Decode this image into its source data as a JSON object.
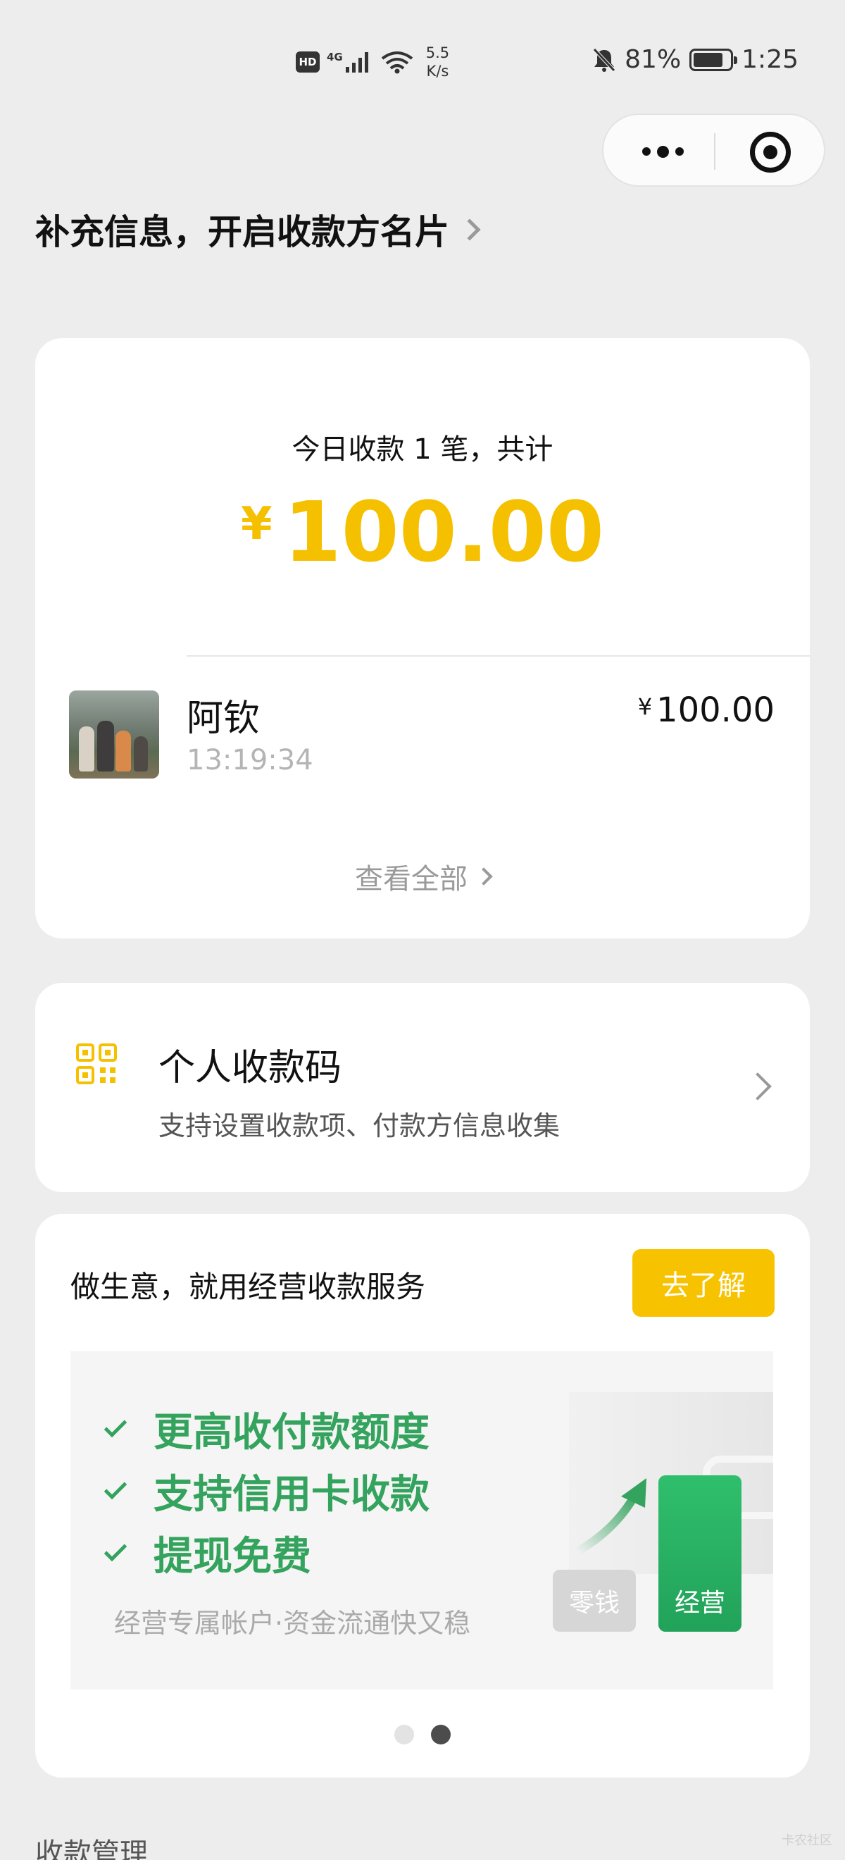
{
  "status_bar": {
    "hd": "HD",
    "network": "4G",
    "speed_value": "5.5",
    "speed_unit": "K/s",
    "battery_percent": "81%",
    "battery_level": 0.81,
    "time": "1:25",
    "icons": [
      "hd-icon",
      "signal-icon",
      "wifi-icon",
      "mute-bell-icon",
      "battery-icon"
    ]
  },
  "capsule": {
    "more_icon": "more-dots-icon",
    "close_icon": "target-close-icon"
  },
  "header": {
    "title": "补充信息，开启收款方名片"
  },
  "summary": {
    "today_label": "今日收款 1 笔，共计",
    "currency": "¥",
    "total": "100.00",
    "accent_color": "#f5c000",
    "transactions": [
      {
        "name": "阿钦",
        "time": "13:19:34",
        "currency": "¥",
        "amount": "100.00"
      }
    ],
    "view_all": "查看全部"
  },
  "qr_code": {
    "title": "个人收款码",
    "subtitle": "支持设置收款项、付款方信息收集",
    "icon": "qr-code-icon",
    "icon_color": "#f5c000"
  },
  "business": {
    "title": "做生意，就用经营收款服务",
    "button": "去了解",
    "button_color": "#f7c300",
    "banner": {
      "features": [
        "更高收付款额度",
        "支持信用卡收款",
        "提现免费"
      ],
      "feature_color": "#34a35d",
      "subtitle": "经营专属帐户·资金流通快又稳",
      "pill_left": "零钱",
      "pill_right": "经营"
    },
    "carousel": {
      "total": 2,
      "active": 2
    }
  },
  "section": {
    "label": "收款管理"
  },
  "watermark": "卡农社区"
}
